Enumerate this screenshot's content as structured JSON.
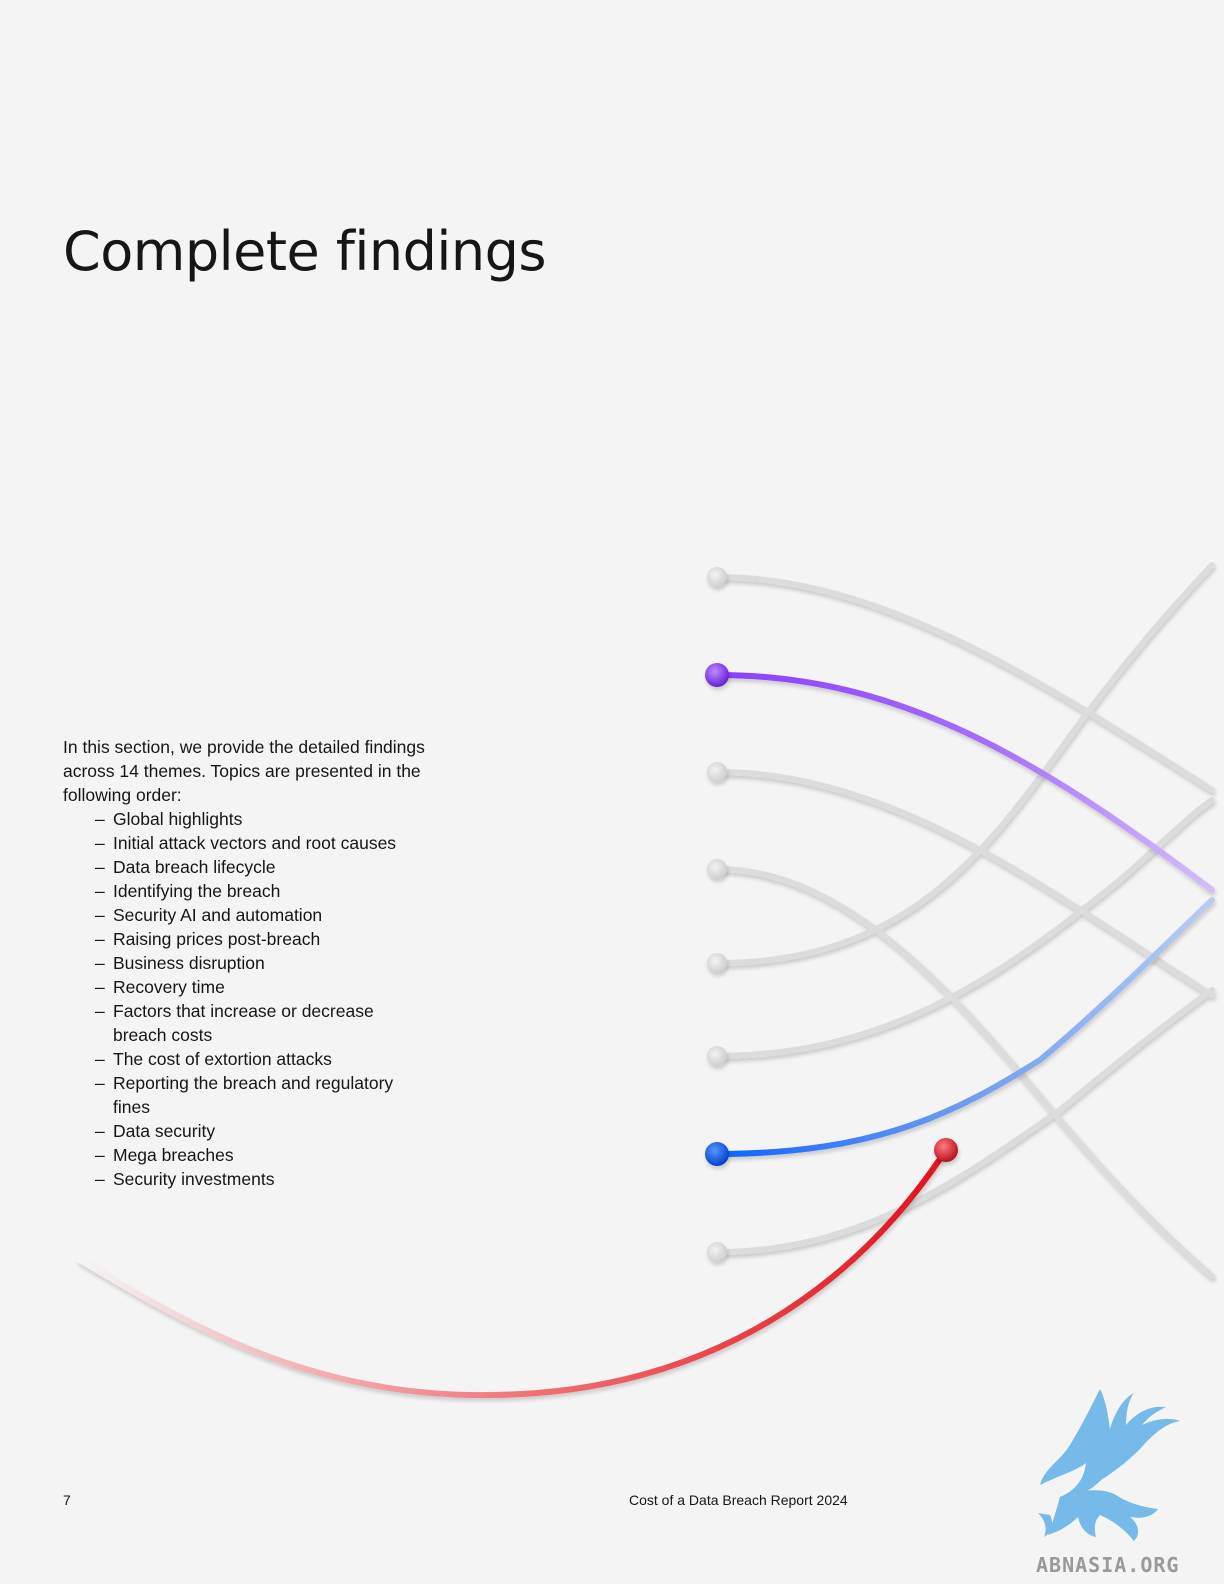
{
  "page": {
    "title": "Complete findings",
    "intro": "In this section, we provide the detailed findings across 14 themes. Topics are presented in the following order:",
    "topics": [
      "Global highlights",
      "Initial attack vectors and root causes",
      "Data breach lifecycle",
      "Identifying the breach",
      "Security AI and automation",
      "Raising prices post-breach",
      "Business disruption",
      "Recovery time",
      "Factors that increase or decrease breach costs",
      "The cost of extortion attacks",
      "Reporting the breach and regulatory fines",
      "Data security",
      "Mega breaches",
      "Security investments"
    ],
    "dash": "–"
  },
  "footer": {
    "page_number": "7",
    "report_title": "Cost of a Data Breach Report 2024"
  },
  "watermark": {
    "text": "ABNASIA.ORG"
  },
  "colors": {
    "background": "#f4f4f4",
    "text": "#161616",
    "gray_line": "#dcdcdc",
    "purple": "#8a3ffc",
    "blue": "#0f62fe",
    "red": "#da1e28",
    "watermark_blue": "#5fb0e6"
  }
}
